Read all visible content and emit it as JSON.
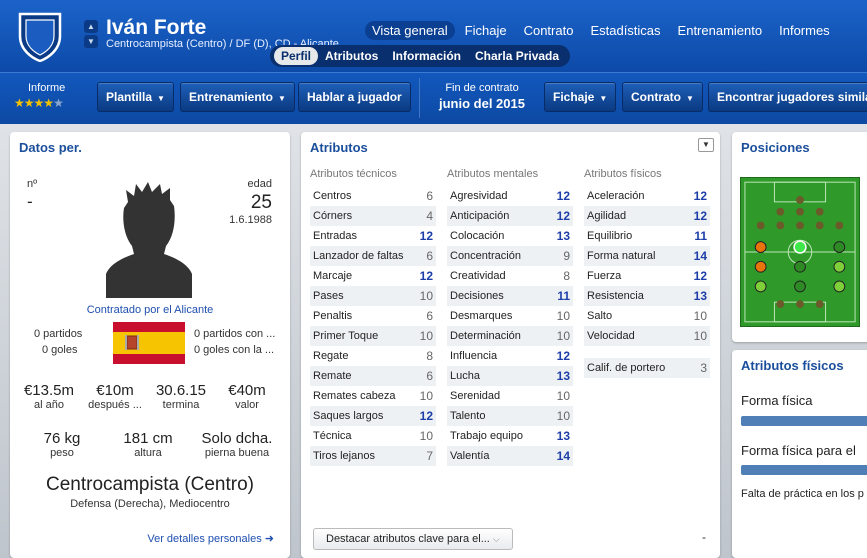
{
  "header": {
    "player_name": "Iván Forte",
    "player_sub": "Centrocampista (Centro) / DF (D), CD - Alicante",
    "nav": [
      "Vista general",
      "Fichaje",
      "Contrato",
      "Estadísticas",
      "Entrenamiento",
      "Informes"
    ],
    "subnav": [
      "Perfil",
      "Atributos",
      "Información",
      "Charla Privada"
    ]
  },
  "toolbar": {
    "report_label": "Informe",
    "report_stars": 3.5,
    "buttons": [
      "Plantilla",
      "Entrenamiento",
      "Hablar a jugador"
    ],
    "contract_label": "Fin de contrato",
    "contract_value": "junio del 2015",
    "buttons_right": [
      "Fichaje",
      "Contrato",
      "Encontrar jugadores similar"
    ]
  },
  "personal": {
    "title": "Datos per.",
    "number_label": "nº",
    "number_value": "-",
    "age_label": "edad",
    "age_value": "25",
    "birth_date": "1.6.1988",
    "contract_text": "Contratado por el Alicante",
    "left_stats": [
      "0 partidos",
      "0 goles"
    ],
    "right_stats": [
      "0 partidos con ...",
      "0 goles con la ..."
    ],
    "money": [
      {
        "value": "€13.5m",
        "caption": "al año"
      },
      {
        "value": "€10m",
        "caption": "después ..."
      },
      {
        "value": "30.6.15",
        "caption": "termina"
      },
      {
        "value": "€40m",
        "caption": "valor"
      }
    ],
    "body": [
      {
        "value": "76 kg",
        "caption": "peso"
      },
      {
        "value": "181 cm",
        "caption": "altura"
      },
      {
        "value": "Solo dcha.",
        "caption": "pierna buena"
      }
    ],
    "position": "Centrocampista (Centro)",
    "position_sub": "Defensa (Derecha), Mediocentro",
    "more_link": "Ver detalles personales"
  },
  "attributes": {
    "title": "Atributos",
    "technical_header": "Atributos técnicos",
    "technical": [
      {
        "name": "Centros",
        "value": "6"
      },
      {
        "name": "Córners",
        "value": "4"
      },
      {
        "name": "Entradas",
        "value": "12"
      },
      {
        "name": "Lanzador de faltas",
        "value": "6"
      },
      {
        "name": "Marcaje",
        "value": "12"
      },
      {
        "name": "Pases",
        "value": "10"
      },
      {
        "name": "Penaltis",
        "value": "6"
      },
      {
        "name": "Primer Toque",
        "value": "10"
      },
      {
        "name": "Regate",
        "value": "8"
      },
      {
        "name": "Remate",
        "value": "6"
      },
      {
        "name": "Remates cabeza",
        "value": "10"
      },
      {
        "name": "Saques largos",
        "value": "12"
      },
      {
        "name": "Técnica",
        "value": "10"
      },
      {
        "name": "Tiros lejanos",
        "value": "7"
      }
    ],
    "mental_header": "Atributos mentales",
    "mental": [
      {
        "name": "Agresividad",
        "value": "12"
      },
      {
        "name": "Anticipación",
        "value": "12"
      },
      {
        "name": "Colocación",
        "value": "13"
      },
      {
        "name": "Concentración",
        "value": "9"
      },
      {
        "name": "Creatividad",
        "value": "8"
      },
      {
        "name": "Decisiones",
        "value": "11"
      },
      {
        "name": "Desmarques",
        "value": "10"
      },
      {
        "name": "Determinación",
        "value": "10"
      },
      {
        "name": "Influencia",
        "value": "12"
      },
      {
        "name": "Lucha",
        "value": "13"
      },
      {
        "name": "Serenidad",
        "value": "10"
      },
      {
        "name": "Talento",
        "value": "10"
      },
      {
        "name": "Trabajo equipo",
        "value": "13"
      },
      {
        "name": "Valentía",
        "value": "14"
      }
    ],
    "physical_header": "Atributos físicos",
    "physical": [
      {
        "name": "Aceleración",
        "value": "12"
      },
      {
        "name": "Agilidad",
        "value": "12"
      },
      {
        "name": "Equilibrio",
        "value": "11"
      },
      {
        "name": "Forma natural",
        "value": "14"
      },
      {
        "name": "Fuerza",
        "value": "12"
      },
      {
        "name": "Resistencia",
        "value": "13"
      },
      {
        "name": "Salto",
        "value": "10"
      },
      {
        "name": "Velocidad",
        "value": "10"
      }
    ],
    "goalkeeper_label": "Calif. de portero",
    "goalkeeper_value": "3",
    "highlight_select": "Destacar atributos clave para el...",
    "bottom_dash": "-"
  },
  "positions": {
    "title": "Posiciones"
  },
  "physical_panel": {
    "title": "Atributos físicos",
    "fitness_label": "Forma física",
    "match_fitness_label": "Forma física para el",
    "practice_label": "Falta de práctica en los p"
  },
  "colors": {
    "header_blue": "#1b63c9",
    "title_blue": "#1b4f9c",
    "high_value": "#1d3ea8",
    "star_gold": "#f2c200"
  }
}
